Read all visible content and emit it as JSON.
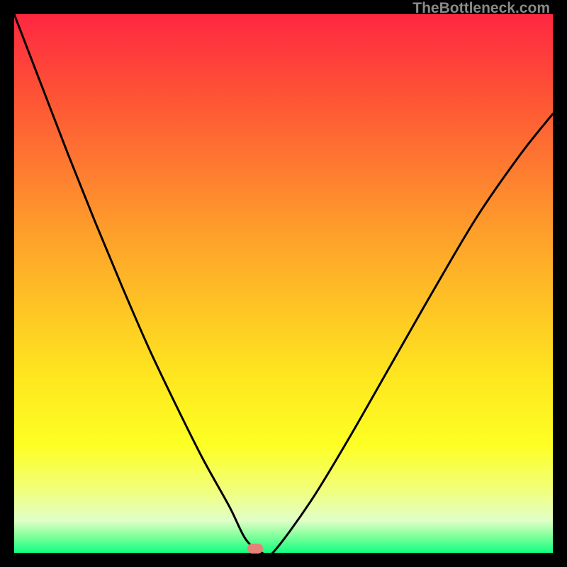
{
  "watermark": "TheBottleneck.com",
  "marker": {
    "x_frac": 0.447,
    "y_frac": 0.992
  },
  "chart_data": {
    "type": "line",
    "title": "",
    "xlabel": "",
    "ylabel": "",
    "xlim": [
      0,
      1
    ],
    "ylim": [
      0,
      1
    ],
    "series": [
      {
        "name": "curve",
        "x": [
          0.0,
          0.05,
          0.1,
          0.15,
          0.2,
          0.25,
          0.3,
          0.35,
          0.4,
          0.43,
          0.46,
          0.48,
          0.55,
          0.62,
          0.7,
          0.78,
          0.86,
          0.94,
          1.0
        ],
        "y": [
          1.0,
          0.87,
          0.74,
          0.615,
          0.495,
          0.38,
          0.275,
          0.175,
          0.085,
          0.025,
          0.0,
          0.0,
          0.095,
          0.21,
          0.35,
          0.49,
          0.625,
          0.74,
          0.815
        ]
      }
    ],
    "gradient_stops": [
      {
        "offset": 0.0,
        "color": "#fe2741"
      },
      {
        "offset": 0.14,
        "color": "#fe5036"
      },
      {
        "offset": 0.28,
        "color": "#fe7931"
      },
      {
        "offset": 0.42,
        "color": "#fea32a"
      },
      {
        "offset": 0.55,
        "color": "#fec624"
      },
      {
        "offset": 0.68,
        "color": "#fee81f"
      },
      {
        "offset": 0.8,
        "color": "#fdff24"
      },
      {
        "offset": 0.88,
        "color": "#f2ff77"
      },
      {
        "offset": 0.94,
        "color": "#e1ffc8"
      },
      {
        "offset": 0.97,
        "color": "#7eff99"
      },
      {
        "offset": 1.0,
        "color": "#11ff82"
      }
    ]
  }
}
